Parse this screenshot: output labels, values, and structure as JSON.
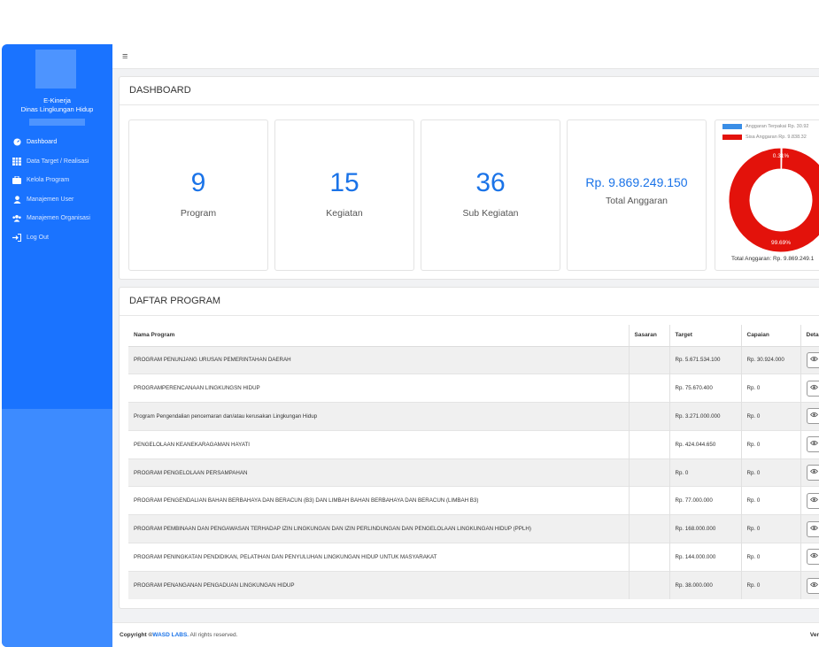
{
  "app": {
    "name": "E-Kinerja",
    "org": "Dinas Lingkungan Hidup"
  },
  "sidebar": {
    "items": [
      {
        "label": "Dashboard",
        "icon": "dashboard-icon"
      },
      {
        "label": "Data Target / Realisasi",
        "icon": "table-icon"
      },
      {
        "label": "Kelola Program",
        "icon": "briefcase-icon"
      },
      {
        "label": "Manajemen User",
        "icon": "user-icon"
      },
      {
        "label": "Manajemen Organisasi",
        "icon": "users-icon"
      },
      {
        "label": "Log Out",
        "icon": "logout-icon"
      }
    ]
  },
  "topbar": {
    "menu_icon": "≡"
  },
  "dashboard": {
    "title": "DASHBOARD",
    "stats": [
      {
        "value": "9",
        "label": "Program"
      },
      {
        "value": "15",
        "label": "Kegiatan"
      },
      {
        "value": "36",
        "label": "Sub Kegiatan"
      },
      {
        "value": "Rp. 9.869.249.150",
        "label": "Total Anggaran"
      }
    ]
  },
  "chart_data": {
    "type": "pie",
    "labels": [
      "Anggaran Terpakai Rp. 30.92",
      "Sisa Anggaran Rp. 9.838.32"
    ],
    "values": [
      0.31,
      99.69
    ],
    "slice_labels": [
      "0.31%",
      "99.69%"
    ],
    "colors": [
      "#3a8ee6",
      "#e3120b"
    ],
    "footer": "Total Anggaran: Rp. 9.869.249.1"
  },
  "program": {
    "title": "DAFTAR PROGRAM",
    "columns": [
      "Nama Program",
      "Sasaran",
      "Target",
      "Capaian",
      "Deta"
    ],
    "rows": [
      {
        "nama": "PROGRAM PENUNJANG URUSAN PEMERINTAHAN DAERAH",
        "sasaran": "",
        "target": "Rp. 5.671.534.100",
        "capaian": "Rp. 30.924.000"
      },
      {
        "nama": "PROGRAMPERENCANAAN LINGKUNGSN HIDUP",
        "sasaran": "",
        "target": "Rp. 75.670.400",
        "capaian": "Rp. 0"
      },
      {
        "nama": "Program Pengendalian pencemaran dan/atau kerusakan Lingkungan Hidup",
        "sasaran": "",
        "target": "Rp. 3.271.000.000",
        "capaian": "Rp. 0"
      },
      {
        "nama": "PENGELOLAAN KEANEKARAGAMAN HAYATI",
        "sasaran": "",
        "target": "Rp. 424.044.650",
        "capaian": "Rp. 0"
      },
      {
        "nama": "PROGRAM PENGELOLAAN PERSAMPAHAN",
        "sasaran": "",
        "target": "Rp. 0",
        "capaian": "Rp. 0"
      },
      {
        "nama": "PROGRAM PENGENDALIAN BAHAN BERBAHAYA DAN BERACUN (B3) DAN LIMBAH BAHAN BERBAHAYA DAN BERACUN (LIMBAH B3)",
        "sasaran": "",
        "target": "Rp. 77.000.000",
        "capaian": "Rp. 0"
      },
      {
        "nama": "PROGRAM PEMBINAAN DAN PENGAWASAN TERHADAP IZIN LINGKUNGAN DAN IZIN PERLINDUNGAN DAN PENGELOLAAN LINGKUNGAN HIDUP (PPLH)",
        "sasaran": "",
        "target": "Rp. 168.000.000",
        "capaian": "Rp. 0"
      },
      {
        "nama": "PROGRAM PENINGKATAN PENDIDIKAN, PELATIHAN DAN PENYULUHAN LINGKUNGAN HIDUP UNTUK MASYARAKAT",
        "sasaran": "",
        "target": "Rp. 144.000.000",
        "capaian": "Rp. 0"
      },
      {
        "nama": "PROGRAM PENANGANAN PENGADUAN LINGKUNGAN HIDUP",
        "sasaran": "",
        "target": "Rp. 38.000.000",
        "capaian": "Rp. 0"
      }
    ],
    "detail_icon": "eye-icon"
  },
  "footer": {
    "copyright_prefix": "Copyright ©",
    "brand": "WASD LABS.",
    "suffix": " All rights reserved.",
    "version": "Ver"
  }
}
